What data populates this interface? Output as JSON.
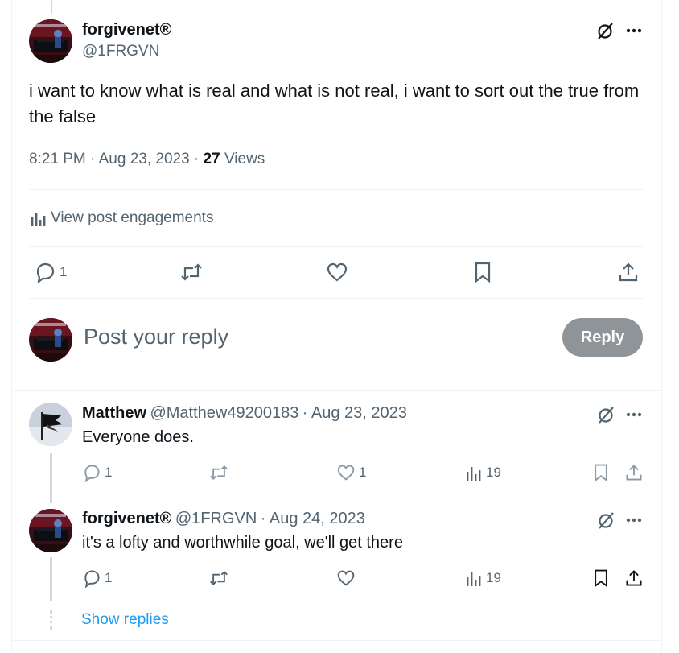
{
  "main_post": {
    "display_name": "forgivenet®",
    "handle": "@1FRGVN",
    "text": "i want to know what is real and what is not real, i want to sort out the true from the false",
    "time": "8:21 PM",
    "date": "Aug 23, 2023",
    "views_count": "27",
    "views_label": "Views",
    "engagements_label": "View post engagements",
    "reply_count": "1"
  },
  "composer": {
    "placeholder": "Post your reply",
    "reply_button": "Reply"
  },
  "replies": [
    {
      "display_name": "Matthew",
      "handle": "@Matthew49200183",
      "date": "Aug 23, 2023",
      "text": "Everyone does.",
      "reply_count": "1",
      "like_count": "1",
      "views_count": "19"
    },
    {
      "display_name": "forgivenet®",
      "handle": "@1FRGVN",
      "date": "Aug 24, 2023",
      "text": "it's a lofty and worthwhile goal, we'll get there",
      "reply_count": "1",
      "views_count": "19"
    }
  ],
  "show_replies_label": "Show replies",
  "separator": "·",
  "colors": {
    "link": "#1d9bf0",
    "secondary_text": "#536471",
    "reply_button_bg": "#8f9499"
  }
}
